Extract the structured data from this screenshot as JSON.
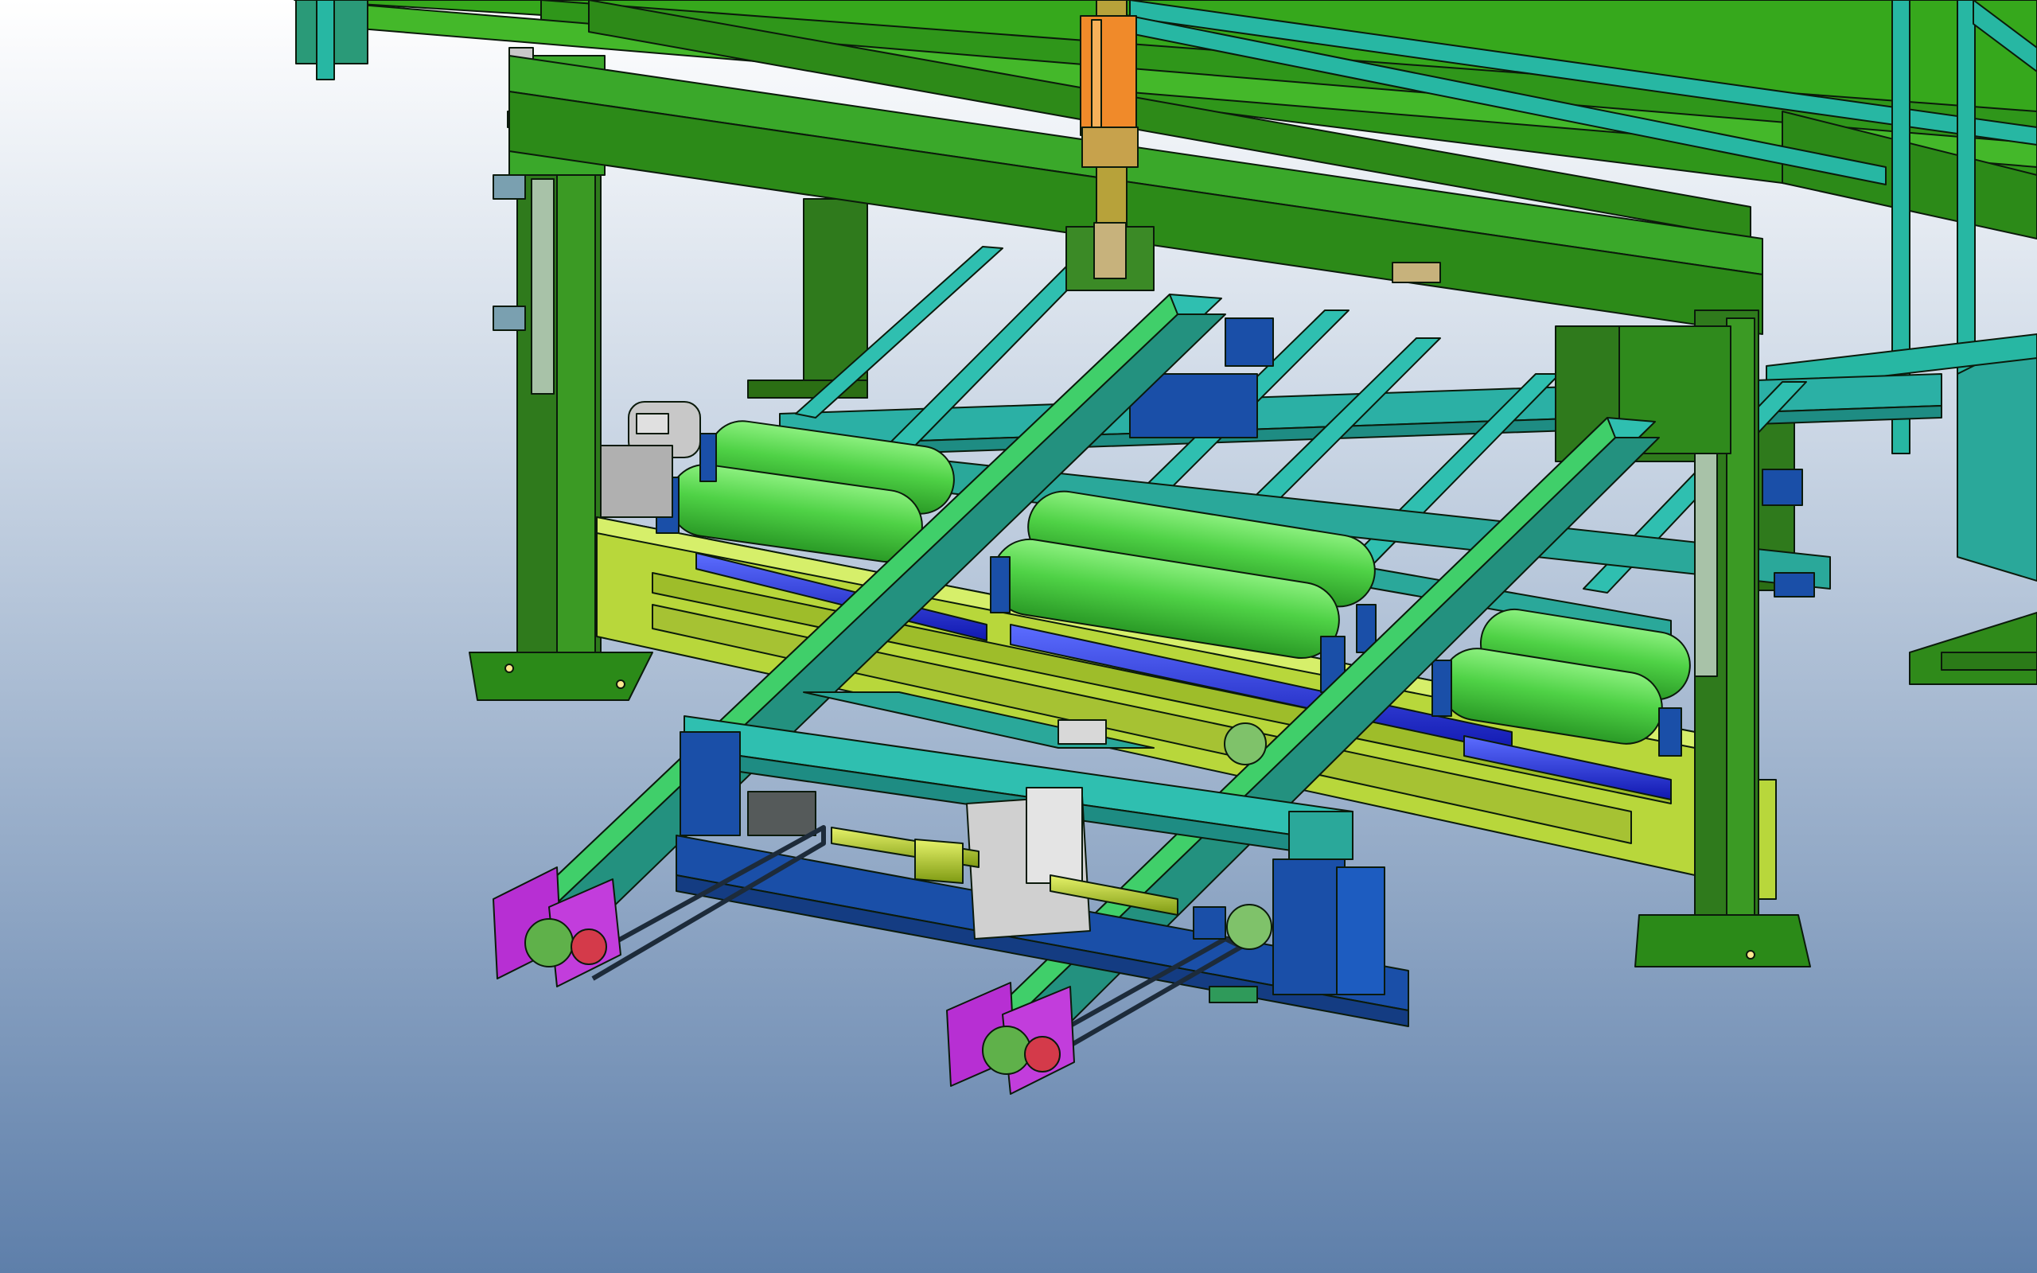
{
  "colors": {
    "background_top": "#ffffff",
    "background_bottom": "#5e7faa",
    "frame_dark_green": "#2f7a1c",
    "frame_green": "#3aa82a",
    "platform_green": "#37a81d",
    "lime_beam": "#b8d73b",
    "roller_green": "#58d94e",
    "cyan_rail": "#2fbfb0",
    "teal": "#2aa89a",
    "blue_base": "#1a4fa8",
    "blue_shaft": "#1c28d8",
    "magenta_plate": "#b72fd3",
    "orange_cylinder": "#f08a2a",
    "gray_motor": "#c8c8c8",
    "handrail": "#27b7a3",
    "edge": "#0b1a0b"
  }
}
